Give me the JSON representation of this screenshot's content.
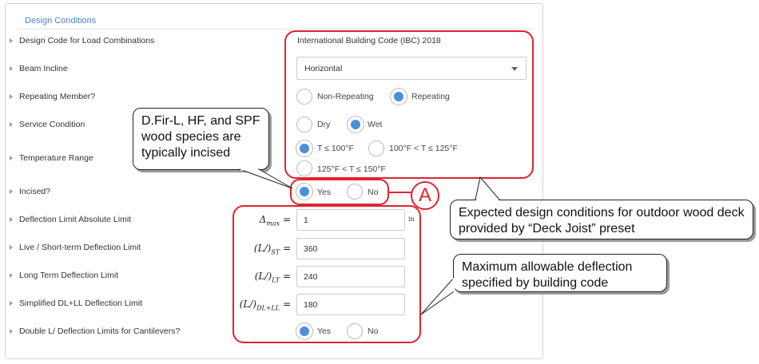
{
  "section_title": "Design Conditions",
  "rows": {
    "design_code": "Design Code for Load Combinations",
    "beam_incline": "Beam Incline",
    "repeating_member": "Repeating Member?",
    "service_condition": "Service Condition",
    "temperature_range": "Temperature Range",
    "incised": "Incised?",
    "deflection_abs": "Deflection Limit Absolute Limit",
    "live_short": "Live / Short-term Deflection Limit",
    "long_term": "Long Term Deflection Limit",
    "simplified": "Simplified DL+LL Deflection Limit",
    "double_l": "Double L/ Deflection Limits for Cantilevers?"
  },
  "values": {
    "design_code": "International Building Code (IBC) 2018",
    "beam_incline": "Horizontal"
  },
  "options": {
    "repeating": [
      {
        "label": "Non-Repeating",
        "selected": false
      },
      {
        "label": "Repeating",
        "selected": true
      }
    ],
    "service": [
      {
        "label": "Dry",
        "selected": false
      },
      {
        "label": "Wet",
        "selected": true
      }
    ],
    "temperature": [
      {
        "label": "T ≤ 100°F",
        "selected": true
      },
      {
        "label": "100°F < T ≤ 125°F",
        "selected": false
      },
      {
        "label": "125°F < T ≤ 150°F",
        "selected": false
      }
    ],
    "incised": [
      {
        "label": "Yes",
        "selected": true
      },
      {
        "label": "No",
        "selected": false
      }
    ],
    "double_l": [
      {
        "label": "Yes",
        "selected": true
      },
      {
        "label": "No",
        "selected": false
      }
    ]
  },
  "deflection": {
    "abs": {
      "symbol": "Δ",
      "sub": "max",
      "value": "1",
      "unit": "in"
    },
    "live": {
      "symbol": "(L/)",
      "sub": "ST",
      "value": "360"
    },
    "long": {
      "symbol": "(L/)",
      "sub": "LT",
      "value": "240"
    },
    "simplified": {
      "symbol": "(L/)",
      "sub": "DL+LL",
      "value": "180"
    }
  },
  "annotations": {
    "incised_callout": "D.Fir-L, HF, and SPF wood species are typically incised",
    "marker": "A",
    "preset_callout": "Expected design conditions for  outdoor wood deck provided by “Deck Joist” preset",
    "code_callout": "Maximum allowable deflection specified by building code"
  },
  "colors": {
    "accent": "#4a90d9",
    "annotation": "#e0242f",
    "title": "#4a86c5"
  }
}
